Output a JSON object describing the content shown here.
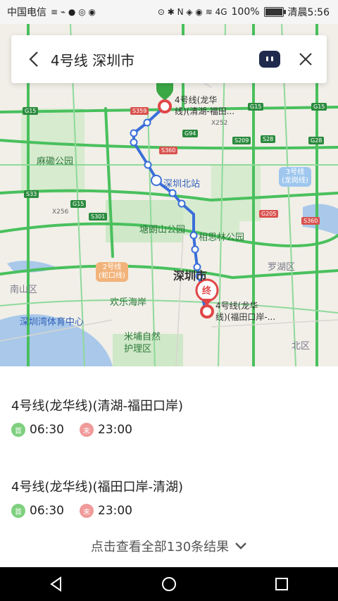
{
  "status": {
    "carrier": "中国电信",
    "extra_icons": "≡ ⌁ ● ◎ ◉",
    "right_icons": "⊙ ✱ N ◈ ◉ ≋ 4G",
    "battery": "100%",
    "time": "清晨5:56"
  },
  "search": {
    "title": "4号线 深圳市"
  },
  "map": {
    "labels": {
      "start_stop": "4号线(龙华\n线)(清湖-福田...",
      "end_stop": "4号线(龙华\n线)(福田口岸-...",
      "start_marker": "起",
      "end_marker": "终",
      "maluan": "麻磡公园",
      "shenzhen_north": "深圳北站",
      "tanglang": "塘朗山公园",
      "xiangsi": "相思林公园",
      "shenzhen_city": "深圳市",
      "luohu": "罗湖区",
      "nanshan": "南山区",
      "huanle": "欢乐海岸",
      "sports": "深圳湾体育中心",
      "mipu": "米埔自然\n护理区",
      "beiqu": "北区",
      "line3": "3号线\n(龙岗线)",
      "line2": "2号线\n(蛇口线)"
    },
    "shields": [
      "G15",
      "G15",
      "G15",
      "G94",
      "S359",
      "S209",
      "S28",
      "G28",
      "S360",
      "S33",
      "G15",
      "S301",
      "G205",
      "S360",
      "X256",
      "X252"
    ],
    "colors": {
      "route": "#3a6fd8",
      "start": "#3aa845",
      "end": "#e04646",
      "road": "#3cc25a"
    }
  },
  "results": [
    {
      "name": "4号线(龙华线)(清湖-福田口岸)",
      "first_label": "首",
      "first_time": "06:30",
      "last_label": "末",
      "last_time": "23:00"
    },
    {
      "name": "4号线(龙华线)(福田口岸-清湖)",
      "first_label": "首",
      "first_time": "06:30",
      "last_label": "末",
      "last_time": "23:00"
    }
  ],
  "more": "点击查看全部130条结果"
}
